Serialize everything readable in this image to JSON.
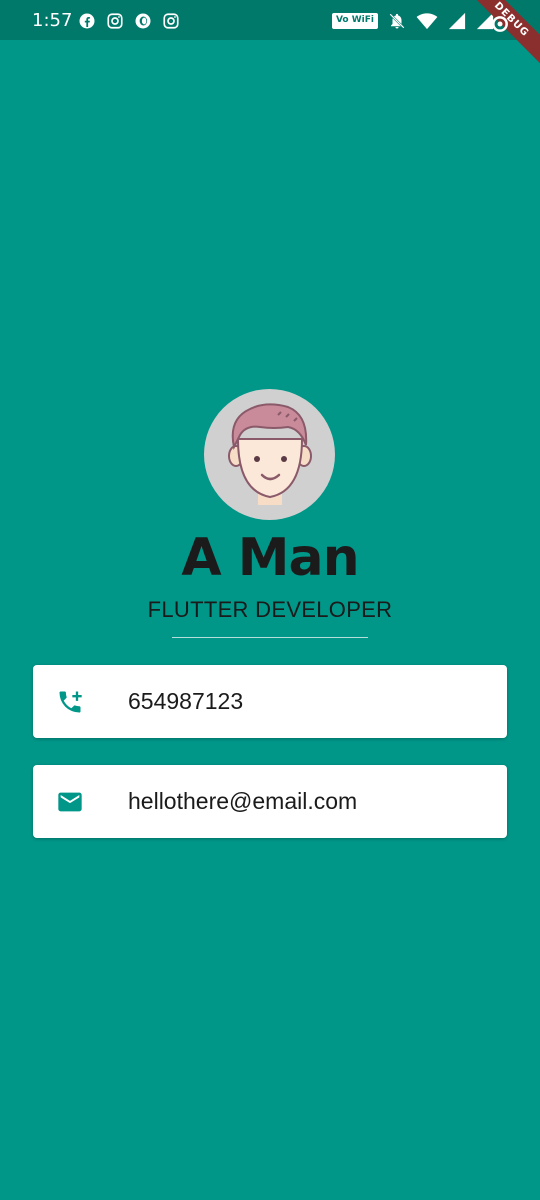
{
  "status_bar": {
    "time": "1:57",
    "notification_icons": [
      "facebook-icon",
      "instagram-icon",
      "opera-icon",
      "instagram-icon"
    ],
    "vowifi_label": "Vo WiFi",
    "system_icons": [
      "vowifi-icon",
      "notifications-off-icon",
      "wifi-icon",
      "signal-icon",
      "signal-roaming-icon"
    ]
  },
  "debug_banner": {
    "label": "DEBUG"
  },
  "profile": {
    "name": "A Man",
    "title": "FLUTTER DEVELOPER",
    "avatar": "avatar-illustration-man"
  },
  "contacts": [
    {
      "icon": "phone-add-icon",
      "value": "654987123"
    },
    {
      "icon": "email-icon",
      "value": "hellothere@email.com"
    }
  ],
  "colors": {
    "background": "#009688",
    "status_bar": "#00796B",
    "accent": "#009688",
    "card": "#FFFFFF",
    "text": "#1B1B1B"
  }
}
